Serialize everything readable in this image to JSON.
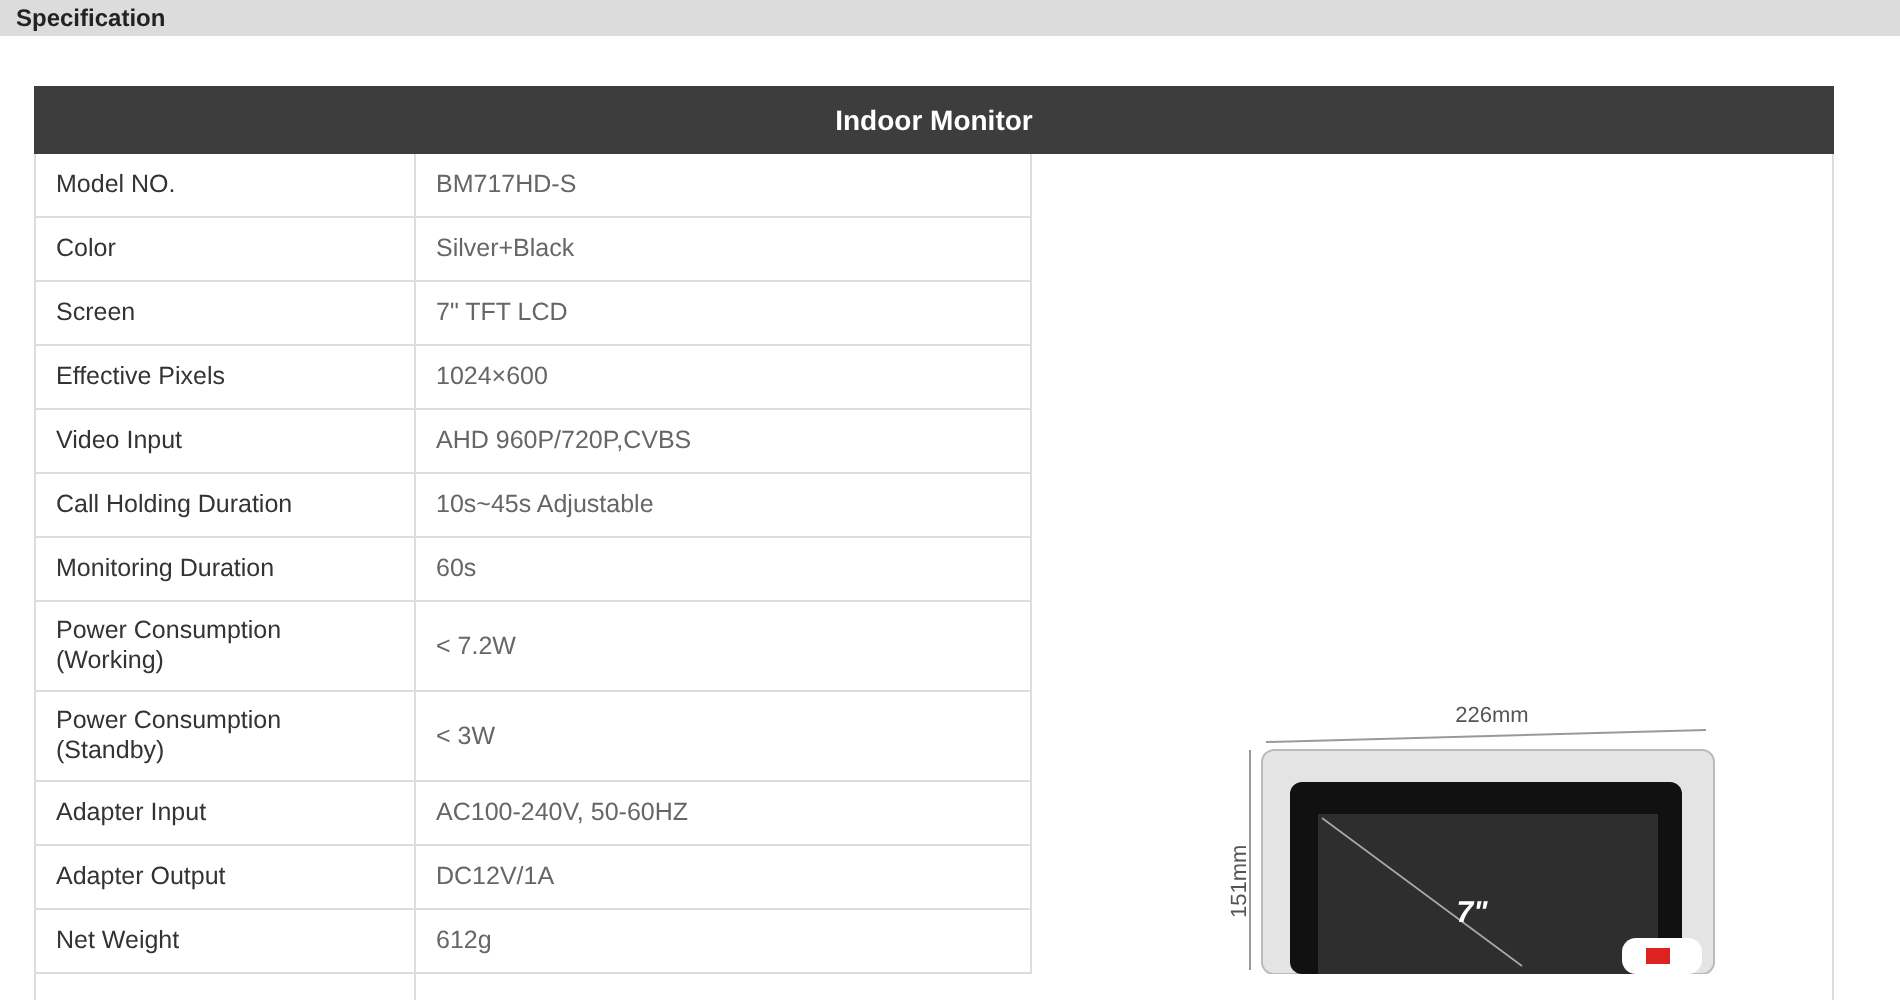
{
  "section_title": "Specification",
  "table": {
    "title": "Indoor Monitor",
    "rows": [
      {
        "label": "Model NO.",
        "value": "BM717HD-S"
      },
      {
        "label": "Color",
        "value": "Silver+Black"
      },
      {
        "label": "Screen",
        "value": "7\" TFT LCD"
      },
      {
        "label": "Effective Pixels",
        "value": "1024×600"
      },
      {
        "label": "Video Input",
        "value": "AHD 960P/720P,CVBS"
      },
      {
        "label": "Call Holding Duration",
        "value": "10s~45s Adjustable"
      },
      {
        "label": "Monitoring Duration",
        "value": "60s"
      },
      {
        "label": "Power Consumption\n(Working)",
        "value": "< 7.2W"
      },
      {
        "label": "Power Consumption\n(Standby)",
        "value": "< 3W"
      },
      {
        "label": "Adapter Input",
        "value": "AC100-240V, 50-60HZ"
      },
      {
        "label": "Adapter Output",
        "value": "DC12V/1A"
      },
      {
        "label": "Net Weight",
        "value": "612g"
      }
    ],
    "image": {
      "width_label": "226mm",
      "height_label": "151mm",
      "screen_label": "7\""
    }
  }
}
